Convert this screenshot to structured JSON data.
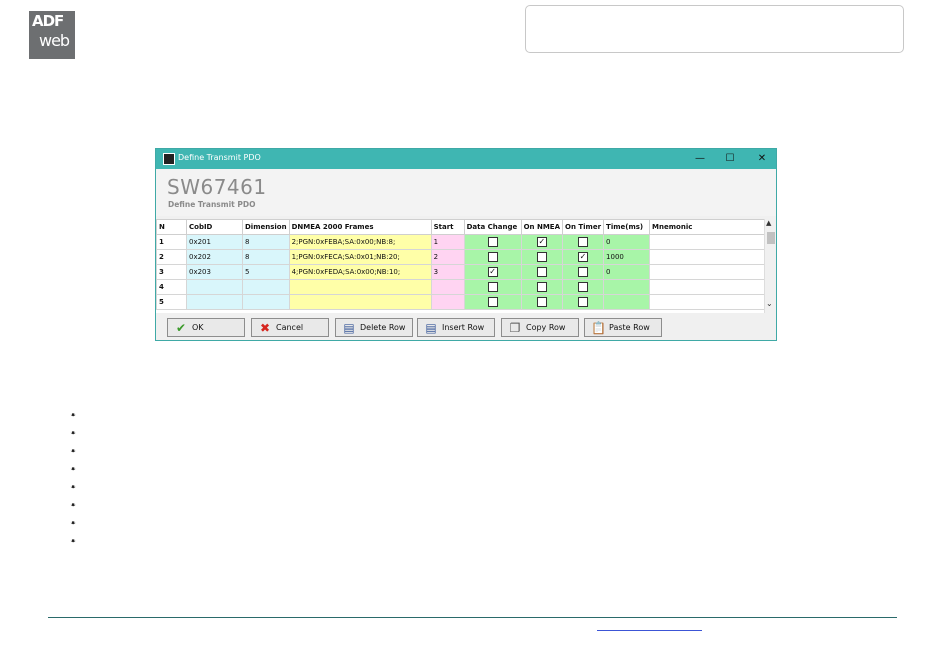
{
  "logo": {
    "line1": "ADF",
    "line2": "web"
  },
  "window": {
    "title": "Define Transmit PDO",
    "code": "SW67461",
    "subtitle": "Define Transmit PDO",
    "controls": {
      "minimize": "—",
      "maximize": "☐",
      "close": "✕"
    }
  },
  "table": {
    "columns": [
      "N",
      "CobID",
      "Dimension",
      "DNMEA 2000 Frames",
      "Start",
      "Data Change",
      "On NMEA",
      "On Timer",
      "Time(ms)",
      "Mnemonic"
    ],
    "rows": [
      {
        "n": "1",
        "cobid": "0x201",
        "dimension": "8",
        "frames": "2;PGN:0xFEBA;SA:0x00;NB:8;",
        "start": "1",
        "data_change": false,
        "on_nmea": true,
        "on_timer": false,
        "time": "0",
        "mnemonic": ""
      },
      {
        "n": "2",
        "cobid": "0x202",
        "dimension": "8",
        "frames": "1;PGN:0xFECA;SA:0x01;NB:20;",
        "start": "2",
        "data_change": false,
        "on_nmea": false,
        "on_timer": true,
        "time": "1000",
        "mnemonic": ""
      },
      {
        "n": "3",
        "cobid": "0x203",
        "dimension": "5",
        "frames": "4;PGN:0xFEDA;SA:0x00;NB:10;",
        "start": "3",
        "data_change": true,
        "on_nmea": false,
        "on_timer": false,
        "time": "0",
        "mnemonic": ""
      },
      {
        "n": "4",
        "cobid": "",
        "dimension": "",
        "frames": "",
        "start": "",
        "data_change": false,
        "on_nmea": false,
        "on_timer": false,
        "time": "",
        "mnemonic": ""
      },
      {
        "n": "5",
        "cobid": "",
        "dimension": "",
        "frames": "",
        "start": "",
        "data_change": false,
        "on_nmea": false,
        "on_timer": false,
        "time": "",
        "mnemonic": ""
      }
    ]
  },
  "buttons": {
    "ok": "OK",
    "cancel": "Cancel",
    "delete_row": "Delete Row",
    "insert_row": "Insert Row",
    "copy_row": "Copy Row",
    "paste_row": "Paste Row"
  },
  "colors": {
    "titlebar": "#3fb6b2",
    "cobid_bg": "#d9f6fb",
    "frames_bg": "#ffffa8",
    "start_bg": "#ffd4f2",
    "check_bg": "#a8f5a8"
  },
  "bullet_count": 8
}
